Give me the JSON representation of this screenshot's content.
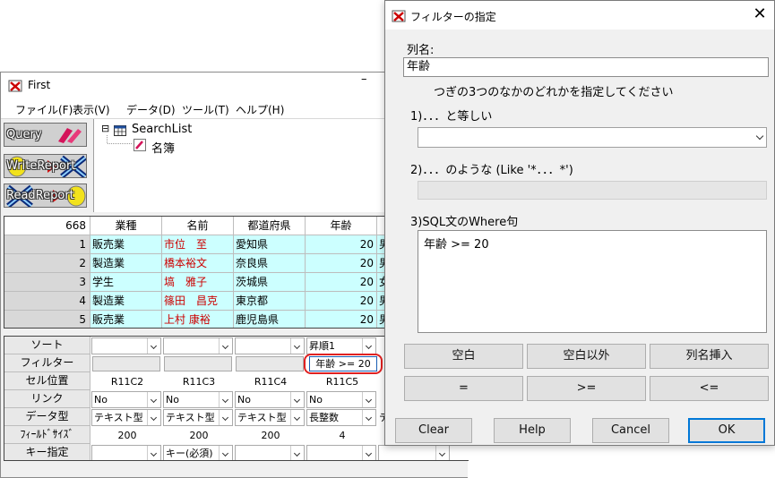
{
  "main": {
    "title": "First",
    "minimize": "–",
    "menus": [
      "ファイル(F)",
      "表示(V)",
      "データ(D)",
      "ツール(T)",
      "ヘルプ(H)"
    ],
    "toolbar": {
      "query_label": "Query",
      "write_label": "WriteReport",
      "read_label": "ReadReport"
    },
    "tree": {
      "root_expander": "⊟",
      "root": "SearchList",
      "child": "名簿"
    },
    "grid": {
      "count": "668",
      "columns": [
        "業種",
        "名前",
        "都道府県",
        "年齢"
      ],
      "rows": [
        {
          "n": "1",
          "c1": "販売業",
          "c2": "市位　至",
          "c3": "愛知県",
          "c4": "20",
          "c5": "男"
        },
        {
          "n": "2",
          "c1": "製造業",
          "c2": "橋本裕文",
          "c3": "奈良県",
          "c4": "20",
          "c5": "男"
        },
        {
          "n": "3",
          "c1": "学生",
          "c2": "塙　雅子",
          "c3": "茨城県",
          "c4": "20",
          "c5": "女"
        },
        {
          "n": "4",
          "c1": "製造業",
          "c2": "篠田　昌克",
          "c3": "東京都",
          "c4": "20",
          "c5": "男"
        },
        {
          "n": "5",
          "c1": "販売業",
          "c2": "上村 康裕",
          "c3": "鹿児島県",
          "c4": "20",
          "c5": "男"
        }
      ]
    },
    "props": {
      "labels": [
        "ソート",
        "フィルター",
        "セル位置",
        "リンク",
        "データ型",
        "ﾌｨｰﾙﾄﾞｻｲｽﾞ",
        "キー指定"
      ],
      "sort": [
        "",
        "",
        "",
        "昇順1"
      ],
      "filter_value": "年齢 >= 20",
      "cell_pos": [
        "R11C2",
        "R11C3",
        "R11C4",
        "R11C5"
      ],
      "link": [
        "No",
        "No",
        "No",
        "No"
      ],
      "dtype": [
        "テキスト型",
        "テキスト型",
        "テキスト型",
        "長整数"
      ],
      "dtype_partial": "テ",
      "fsize": [
        "200",
        "200",
        "200",
        "4"
      ],
      "key": [
        "",
        "キー(必須)",
        "",
        ""
      ]
    }
  },
  "dialog": {
    "title": "フィルターの指定",
    "close": "✕",
    "col_label": "列名:",
    "col_value": "年齢",
    "instruction": "つぎの3つのなかのどれかを指定してください",
    "opt1": "1)．．．と等しい",
    "opt2": "2)．．．のような (Like '*．．．*')",
    "opt3": "3)SQL文のWhere句",
    "where_value": "年齢 >= 20",
    "buttons": {
      "blank": "空白",
      "not_blank": "空白以外",
      "insert": "列名挿入",
      "eq": "=",
      "ge": ">=",
      "le": "<=",
      "clear": "Clear",
      "help": "Help",
      "cancel": "Cancel",
      "ok": "OK"
    }
  },
  "colors": {
    "data_cell": "#ccffff",
    "name_text": "#cc0000",
    "filter_highlight": "#e02020",
    "ok_border": "#0078d7"
  }
}
